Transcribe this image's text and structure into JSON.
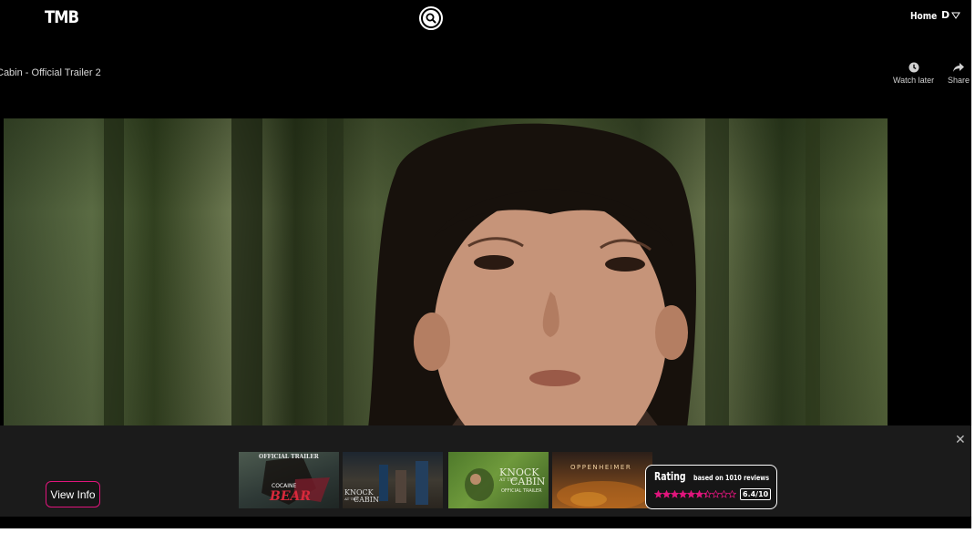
{
  "header": {
    "logo": "TMB",
    "nav_home": "Home",
    "user_initial": "D"
  },
  "video": {
    "title": "Cabin - Official Trailer 2",
    "actions": {
      "watch_later": "Watch later",
      "share": "Share"
    }
  },
  "bottom_bar": {
    "view_info_label": "View Info",
    "close_glyph": "✕",
    "thumbnails": [
      {
        "name": "cocaine-bear",
        "top_caption": "OFFICIAL TRAILER",
        "line1": "COCAINE",
        "line2": "BEAR"
      },
      {
        "name": "knock-at-the-cabin",
        "line1": "KNOCK",
        "line2": "AT THE",
        "line3": "CABIN"
      },
      {
        "name": "knock-at-the-cabin-official-trailer",
        "line1": "KNOCK",
        "line2": "AT THE",
        "line3": "CABIN",
        "line4": "OFFICIAL TRAILER"
      },
      {
        "name": "oppenheimer",
        "line1": "OPPENHEIMER"
      }
    ],
    "rating": {
      "label": "Rating",
      "reviews": "based on 1010 reviews",
      "score_text": "6.4/10",
      "score_value": 6.4,
      "max_stars": 10
    }
  },
  "colors": {
    "accent": "#e0157c",
    "star_filled": "#e0157c",
    "background": "#000000",
    "bar_background": "#1b1b1b"
  },
  "icons": {
    "search": "search-icon",
    "watch_later": "clock-icon",
    "share": "share-arrow-icon",
    "dropdown": "triangle-down-icon",
    "close": "close-icon"
  }
}
